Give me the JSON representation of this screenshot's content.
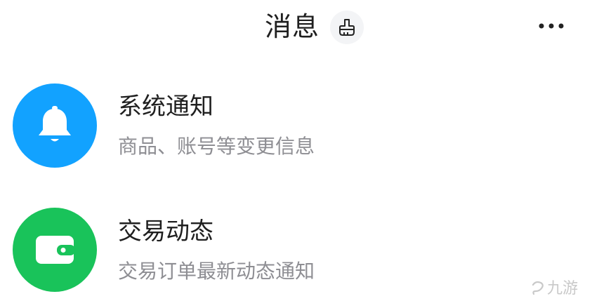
{
  "header": {
    "title": "消息",
    "clean_icon": "broom-icon",
    "more_icon": "more-dots-icon"
  },
  "messages": [
    {
      "title": "系统通知",
      "subtitle": "商品、账号等变更信息",
      "icon": "bell-icon",
      "color": "#12a2ff"
    },
    {
      "title": "交易动态",
      "subtitle": "交易订单最新动态通知",
      "icon": "wallet-icon",
      "color": "#19c35a"
    }
  ],
  "watermark": {
    "text": "九游"
  }
}
